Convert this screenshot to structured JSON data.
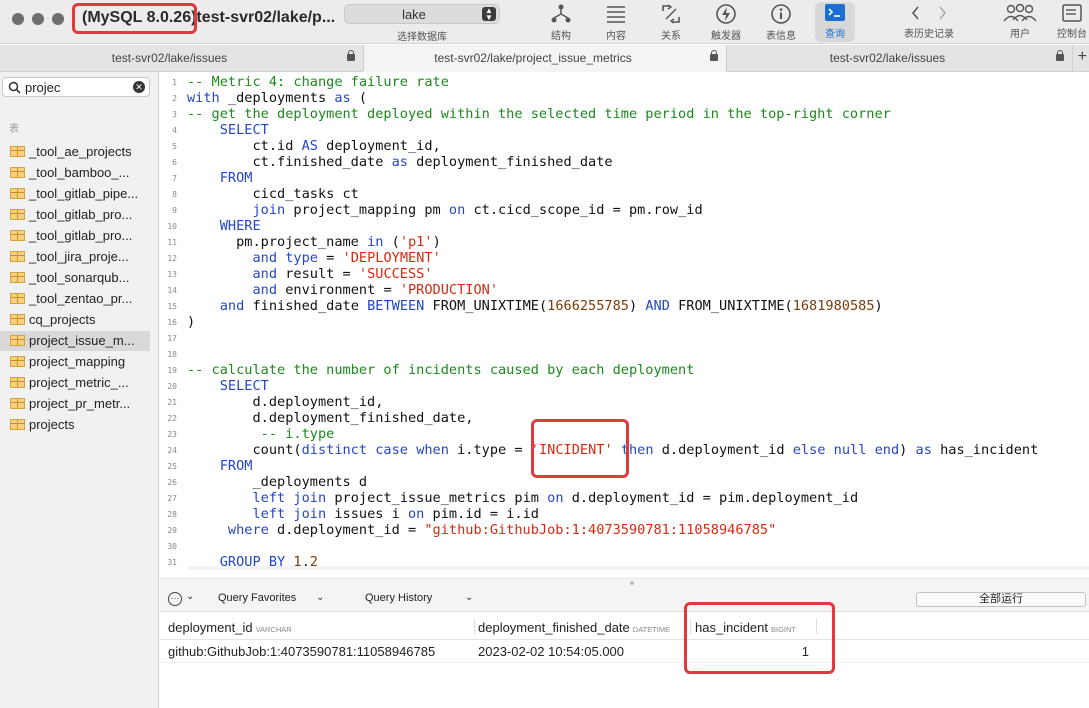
{
  "window": {
    "server_version": "(MySQL 8.0.26)",
    "title": "test-svr02/lake/p..."
  },
  "toolbar": {
    "database": {
      "value": "lake",
      "label": "选择数据库"
    },
    "buttons": [
      {
        "icon": "structure-icon",
        "label": "结构"
      },
      {
        "icon": "content-icon",
        "label": "内容"
      },
      {
        "icon": "relations-icon",
        "label": "关系"
      },
      {
        "icon": "triggers-icon",
        "label": "触发器"
      },
      {
        "icon": "table-info-icon",
        "label": "表信息"
      },
      {
        "icon": "query-icon",
        "label": "查询"
      },
      {
        "icon": "history-nav-icon",
        "label": "表历史记录"
      },
      {
        "icon": "users-icon",
        "label": "用户"
      },
      {
        "icon": "console-icon",
        "label": "控制台"
      }
    ]
  },
  "tabs": [
    {
      "label": "test-svr02/lake/issues"
    },
    {
      "label": "test-svr02/lake/project_issue_metrics"
    },
    {
      "label": "test-svr02/lake/issues"
    }
  ],
  "sidebar": {
    "search_value": "projec",
    "section": "表",
    "tables": [
      "_tool_ae_projects",
      "_tool_bamboo_...",
      "_tool_gitlab_pipe...",
      "_tool_gitlab_pro...",
      "_tool_gitlab_pro...",
      "_tool_jira_proje...",
      "_tool_sonarqub...",
      "_tool_zentao_pr...",
      "cq_projects",
      "project_issue_m...",
      "project_mapping",
      "project_metric_...",
      "project_pr_metr...",
      "projects"
    ]
  },
  "editor": {
    "line_numbers": [
      "1",
      "2",
      "3",
      "4",
      "5",
      "6",
      "7",
      "8",
      "9",
      "10",
      "11",
      "12",
      "13",
      "14",
      "15",
      "16",
      "17",
      "18",
      "19",
      "20",
      "21",
      "22",
      "23",
      "24",
      "25",
      "26",
      "27",
      "28",
      "29",
      "30",
      "31"
    ],
    "lines": [
      [
        {
          "t": "-- Metric 4: change failure rate",
          "c": "cm"
        }
      ],
      [
        {
          "t": "with",
          "c": "kw"
        },
        {
          "t": " _deployments ",
          "c": ""
        },
        {
          "t": "as",
          "c": "kw"
        },
        {
          "t": " (",
          "c": ""
        }
      ],
      [
        {
          "t": "-- get the deployment deployed within the selected time period in the top-right corner",
          "c": "cm"
        }
      ],
      [
        {
          "t": "    ",
          "c": ""
        },
        {
          "t": "SELECT",
          "c": "kw"
        }
      ],
      [
        {
          "t": "        ct.id ",
          "c": ""
        },
        {
          "t": "AS",
          "c": "kw"
        },
        {
          "t": " deployment_id,",
          "c": ""
        }
      ],
      [
        {
          "t": "        ct.finished_date ",
          "c": ""
        },
        {
          "t": "as",
          "c": "kw"
        },
        {
          "t": " deployment_finished_date",
          "c": ""
        }
      ],
      [
        {
          "t": "    ",
          "c": ""
        },
        {
          "t": "FROM",
          "c": "kw"
        }
      ],
      [
        {
          "t": "        cicd_tasks ct",
          "c": ""
        }
      ],
      [
        {
          "t": "        ",
          "c": ""
        },
        {
          "t": "join",
          "c": "kw"
        },
        {
          "t": " project_mapping pm ",
          "c": ""
        },
        {
          "t": "on",
          "c": "kw"
        },
        {
          "t": " ct.cicd_scope_id = pm.row_id",
          "c": ""
        }
      ],
      [
        {
          "t": "    ",
          "c": ""
        },
        {
          "t": "WHERE",
          "c": "kw"
        }
      ],
      [
        {
          "t": "      pm.project_name ",
          "c": ""
        },
        {
          "t": "in",
          "c": "kw"
        },
        {
          "t": " (",
          "c": ""
        },
        {
          "t": "'p1'",
          "c": "st"
        },
        {
          "t": ")",
          "c": ""
        }
      ],
      [
        {
          "t": "        ",
          "c": ""
        },
        {
          "t": "and",
          "c": "kw"
        },
        {
          "t": " ",
          "c": ""
        },
        {
          "t": "type",
          "c": "kw"
        },
        {
          "t": " = ",
          "c": ""
        },
        {
          "t": "'DEPLOYMENT'",
          "c": "st"
        }
      ],
      [
        {
          "t": "        ",
          "c": ""
        },
        {
          "t": "and",
          "c": "kw"
        },
        {
          "t": " result = ",
          "c": ""
        },
        {
          "t": "'SUCCESS'",
          "c": "st"
        }
      ],
      [
        {
          "t": "        ",
          "c": ""
        },
        {
          "t": "and",
          "c": "kw"
        },
        {
          "t": " environment = ",
          "c": ""
        },
        {
          "t": "'PRODUCTION'",
          "c": "st"
        }
      ],
      [
        {
          "t": "    ",
          "c": ""
        },
        {
          "t": "and",
          "c": "kw"
        },
        {
          "t": " finished_date ",
          "c": ""
        },
        {
          "t": "BETWEEN",
          "c": "kw"
        },
        {
          "t": " FROM_UNIXTIME(",
          "c": ""
        },
        {
          "t": "1666255785",
          "c": "nu"
        },
        {
          "t": ") ",
          "c": ""
        },
        {
          "t": "AND",
          "c": "kw"
        },
        {
          "t": " FROM_UNIXTIME(",
          "c": ""
        },
        {
          "t": "1681980585",
          "c": "nu"
        },
        {
          "t": ")",
          "c": ""
        }
      ],
      [
        {
          "t": ")",
          "c": ""
        }
      ],
      [
        {
          "t": "",
          "c": ""
        }
      ],
      [
        {
          "t": "",
          "c": ""
        }
      ],
      [
        {
          "t": "-- calculate the number of incidents caused by each deployment",
          "c": "cm"
        }
      ],
      [
        {
          "t": "    ",
          "c": ""
        },
        {
          "t": "SELECT",
          "c": "kw"
        }
      ],
      [
        {
          "t": "        d.deployment_id,",
          "c": ""
        }
      ],
      [
        {
          "t": "        d.deployment_finished_date,",
          "c": ""
        }
      ],
      [
        {
          "t": "         ",
          "c": ""
        },
        {
          "t": "-- i.type",
          "c": "cm"
        }
      ],
      [
        {
          "t": "        count(",
          "c": ""
        },
        {
          "t": "distinct",
          "c": "kw"
        },
        {
          "t": " ",
          "c": ""
        },
        {
          "t": "case",
          "c": "kw"
        },
        {
          "t": " ",
          "c": ""
        },
        {
          "t": "when",
          "c": "kw"
        },
        {
          "t": " i.type = ",
          "c": ""
        },
        {
          "t": "'INCIDENT'",
          "c": "st"
        },
        {
          "t": " ",
          "c": ""
        },
        {
          "t": "then",
          "c": "kw"
        },
        {
          "t": " d.deployment_id ",
          "c": ""
        },
        {
          "t": "else",
          "c": "kw"
        },
        {
          "t": " ",
          "c": ""
        },
        {
          "t": "null",
          "c": "kw"
        },
        {
          "t": " ",
          "c": ""
        },
        {
          "t": "end",
          "c": "kw"
        },
        {
          "t": ") ",
          "c": ""
        },
        {
          "t": "as",
          "c": "kw"
        },
        {
          "t": " has_incident",
          "c": ""
        }
      ],
      [
        {
          "t": "    ",
          "c": ""
        },
        {
          "t": "FROM",
          "c": "kw"
        }
      ],
      [
        {
          "t": "        _deployments d",
          "c": ""
        }
      ],
      [
        {
          "t": "        ",
          "c": ""
        },
        {
          "t": "left join",
          "c": "kw"
        },
        {
          "t": " project_issue_metrics pim ",
          "c": ""
        },
        {
          "t": "on",
          "c": "kw"
        },
        {
          "t": " d.deployment_id = pim.deployment_id",
          "c": ""
        }
      ],
      [
        {
          "t": "        ",
          "c": ""
        },
        {
          "t": "left join",
          "c": "kw"
        },
        {
          "t": " issues i ",
          "c": ""
        },
        {
          "t": "on",
          "c": "kw"
        },
        {
          "t": " pim.id = i.id",
          "c": ""
        }
      ],
      [
        {
          "t": "     ",
          "c": ""
        },
        {
          "t": "where",
          "c": "kw"
        },
        {
          "t": " d.deployment_id = ",
          "c": ""
        },
        {
          "t": "\"github:GithubJob:1:4073590781:11058946785\"",
          "c": "st"
        }
      ],
      [
        {
          "t": "",
          "c": ""
        }
      ],
      [
        {
          "t": "    ",
          "c": ""
        },
        {
          "t": "GROUP BY",
          "c": "kw"
        },
        {
          "t": " ",
          "c": ""
        },
        {
          "t": "1",
          "c": "nu"
        },
        {
          "t": ",",
          "c": ""
        },
        {
          "t": "2",
          "c": "nu"
        }
      ]
    ]
  },
  "query_bar": {
    "favorites": "Query Favorites",
    "history": "Query History",
    "run_all": "全部运行"
  },
  "results": {
    "columns": [
      {
        "name": "deployment_id",
        "type": "VARCHAR"
      },
      {
        "name": "deployment_finished_date",
        "type": "DATETIME"
      },
      {
        "name": "has_incident",
        "type": "BIGINT"
      }
    ],
    "rows": [
      [
        "github:GithubJob:1:4073590781:11058946785",
        "2023-02-02 10:54:05.000",
        "1"
      ]
    ]
  },
  "colors": {
    "keyword": "#2346c8",
    "comment": "#1a8a1a",
    "string": "#d42b12",
    "highlight_box": "#e0393e",
    "active_tab": "#1b6fd1"
  }
}
